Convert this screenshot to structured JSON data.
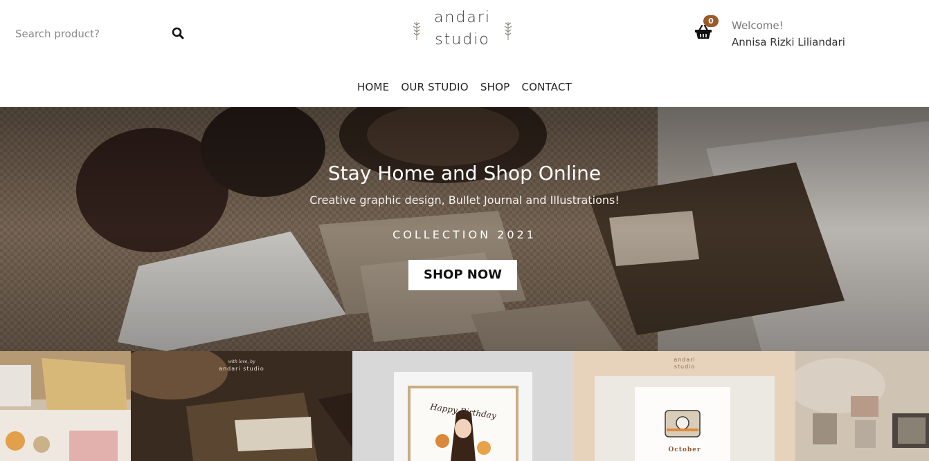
{
  "header": {
    "search_placeholder": "Search product?",
    "logo_line1": "andari",
    "logo_line2": "studio",
    "cart_count": "0",
    "welcome": "Welcome!",
    "username": "Annisa Rizki Liliandari"
  },
  "nav": [
    "HOME",
    "OUR STUDIO",
    "SHOP",
    "CONTACT"
  ],
  "hero": {
    "title": "Stay Home and Shop Online",
    "subtitle": "Creative graphic design, Bullet Journal and Illustrations!",
    "collection": "COLLECTION 2021",
    "button": "SHOP NOW"
  },
  "gallery": {
    "tile2_caption_line1": "with love, by",
    "tile2_caption_line2": "andari studio",
    "tile3_card_text": "Happy Birthday",
    "tile4_brand_line1": "andari",
    "tile4_brand_line2": "studio",
    "tile4_card_text": "October"
  },
  "colors": {
    "accent": "#9b5a2a",
    "header_bg": "#ffffff",
    "text": "#222222"
  },
  "icons": [
    "search-icon",
    "cart-icon",
    "sprig-icon"
  ]
}
